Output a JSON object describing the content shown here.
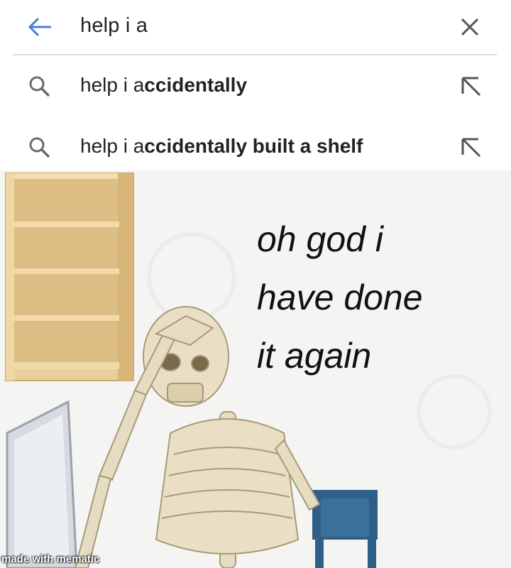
{
  "search": {
    "query": "help i a",
    "back_icon": "arrow-left-icon",
    "clear_icon": "close-icon",
    "accent_color": "#4a7fd6"
  },
  "suggestions": [
    {
      "prefix": "help i a",
      "completion": "ccidentally",
      "icon": "search-icon",
      "fill_icon": "arrow-up-left-icon"
    },
    {
      "prefix": "help i a",
      "completion": "ccidentally built a shelf",
      "icon": "search-icon",
      "fill_icon": "arrow-up-left-icon"
    }
  ],
  "meme": {
    "caption_lines": [
      "oh god i",
      "have done",
      "it again"
    ],
    "watermark": "made with mematic"
  }
}
